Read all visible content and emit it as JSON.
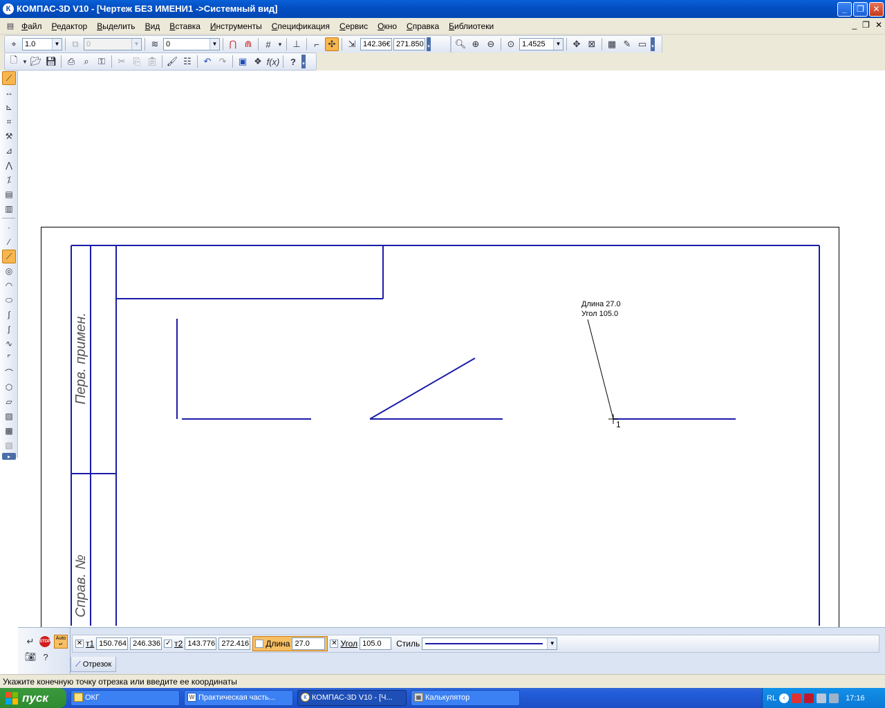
{
  "window": {
    "title": "КОМПАС-3D V10 - [Чертеж БЕЗ ИМЕНИ1 ->Системный вид]",
    "app_icon": "К"
  },
  "menu": [
    "Файл",
    "Редактор",
    "Выделить",
    "Вид",
    "Вставка",
    "Инструменты",
    "Спецификация",
    "Сервис",
    "Окно",
    "Справка",
    "Библиотеки"
  ],
  "toolbar": {
    "scale_value": "1.0",
    "disabled_combo": "0",
    "layer_value": "0",
    "coord_x": "142.36€",
    "coord_y": "271.850",
    "zoom_value": "1.4525"
  },
  "drawing": {
    "annotation_length": "Длина 27.0",
    "annotation_angle": "Угол  105.0",
    "point_label": "1",
    "side_text_1": "Перв. примен.",
    "side_text_2": "Справ. №",
    "line_color": "#1a1aa8"
  },
  "command": {
    "t1_label": "т1",
    "t1_x": "150.764",
    "t1_y": "246.336",
    "t2_label": "т2",
    "t2_x": "143.776",
    "t2_y": "272.416",
    "length_label": "Длина",
    "length_value": "27.0",
    "angle_label": "Угол",
    "angle_value": "105.0",
    "style_label": "Стиль",
    "tab_label": "Отрезок",
    "auto_label": "Auto",
    "stop_label": "STOP"
  },
  "status": "Укажите конечную точку отрезка или введите ее координаты",
  "taskbar": {
    "start_label": "пуск",
    "tasks": [
      "ОКГ",
      "Практическая часть...",
      "КОМПАС-3D V10 - [Ч...",
      "Калькулятор"
    ],
    "lang": "RL",
    "clock": "17:16"
  }
}
